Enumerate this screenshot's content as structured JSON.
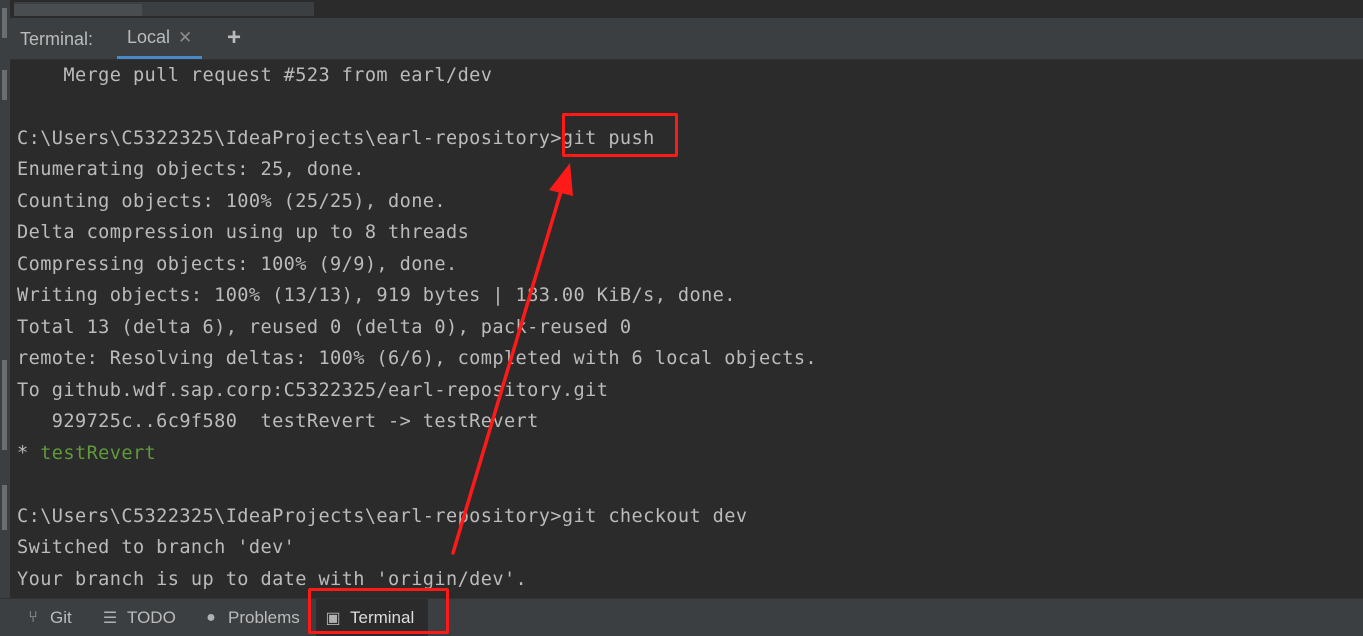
{
  "terminal": {
    "title": "Terminal:",
    "tab_label": "Local",
    "close_glyph": "✕",
    "add_glyph": "+"
  },
  "lines": [
    {
      "text": "    Merge pull request #523 from earl/dev",
      "style": "normal"
    },
    {
      "text": "",
      "style": "normal"
    },
    {
      "text": "C:\\Users\\C5322325\\IdeaProjects\\earl-repository>git push",
      "style": "normal"
    },
    {
      "text": "Enumerating objects: 25, done.",
      "style": "normal"
    },
    {
      "text": "Counting objects: 100% (25/25), done.",
      "style": "normal"
    },
    {
      "text": "Delta compression using up to 8 threads",
      "style": "normal"
    },
    {
      "text": "Compressing objects: 100% (9/9), done.",
      "style": "normal"
    },
    {
      "text": "Writing objects: 100% (13/13), 919 bytes | 183.00 KiB/s, done.",
      "style": "normal"
    },
    {
      "text": "Total 13 (delta 6), reused 0 (delta 0), pack-reused 0",
      "style": "normal"
    },
    {
      "text": "remote: Resolving deltas: 100% (6/6), completed with 6 local objects.",
      "style": "normal"
    },
    {
      "text": "To github.wdf.sap.corp:C5322325/earl-repository.git",
      "style": "normal"
    },
    {
      "text": "   929725c..6c9f580  testRevert -> testRevert",
      "style": "normal"
    },
    {
      "text": "* ",
      "style": "branch",
      "branch": "testRevert"
    },
    {
      "text": "",
      "style": "normal"
    },
    {
      "text": "C:\\Users\\C5322325\\IdeaProjects\\earl-repository>git checkout dev",
      "style": "normal"
    },
    {
      "text": "Switched to branch 'dev'",
      "style": "normal"
    },
    {
      "text": "Your branch is up to date with 'origin/dev'.",
      "style": "normal"
    }
  ],
  "toolbar": {
    "items": [
      {
        "label": "Git",
        "icon": "git-branch-icon",
        "glyph": "⑂"
      },
      {
        "label": "TODO",
        "icon": "list-icon",
        "glyph": "☰"
      },
      {
        "label": "Problems",
        "icon": "info-icon",
        "glyph": "●"
      },
      {
        "label": "Terminal",
        "icon": "terminal-icon",
        "glyph": "▣"
      }
    ]
  },
  "annotation_color": "#ff1a1a"
}
